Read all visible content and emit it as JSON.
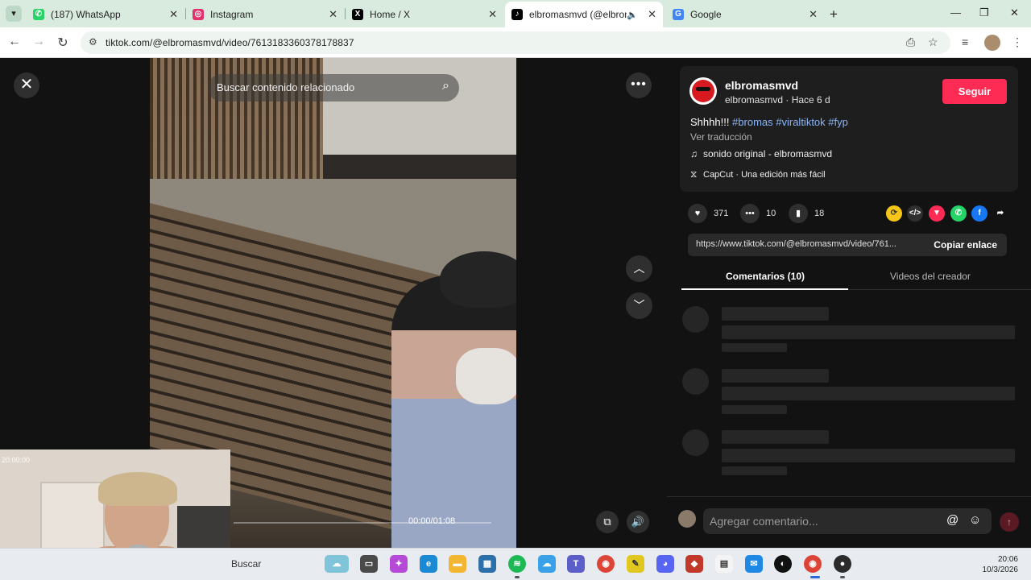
{
  "browser": {
    "tabs": [
      {
        "title": "(187) WhatsApp",
        "favicon": "whatsapp-icon",
        "color": "#25d366"
      },
      {
        "title": "Instagram",
        "favicon": "instagram-icon",
        "color": "#e1306c"
      },
      {
        "title": "Home / X",
        "favicon": "x-icon",
        "color": "#000000"
      },
      {
        "title": "elbromasmvd (@elbromasm",
        "favicon": "tiktok-icon",
        "color": "#000000",
        "active": true
      },
      {
        "title": "Google",
        "favicon": "google-icon",
        "color": "#4285f4"
      }
    ],
    "url": "tiktok.com/@elbromasmvd/video/7613183360378178837"
  },
  "video": {
    "search_placeholder": "Buscar contenido relacionado",
    "time": "00:00/01:08",
    "progress": 0
  },
  "post": {
    "username": "elbromasmvd",
    "subline": "elbromasmvd · Hace 6 d",
    "follow_label": "Seguir",
    "caption_text": "Shhhh!!! ",
    "hashtags": [
      "#bromas",
      "#viraltiktok",
      "#fyp"
    ],
    "translate": "Ver traducción",
    "sound": "sonido original - elbromasmvd",
    "capcut": "CapCut · Una edición más fácil",
    "likes": "371",
    "comments": "10",
    "saves": "18",
    "link": "https://www.tiktok.com/@elbromasmvd/video/761...",
    "copy_label": "Copiar enlace",
    "brand_color": "#fe2c55"
  },
  "panel_tabs": {
    "comments": "Comentarios (10)",
    "creator": "Videos del creador"
  },
  "comment_box": {
    "placeholder": "Agregar comentario..."
  },
  "webcam": {
    "timestamp": "20:00:00"
  },
  "taskbar": {
    "search_label": "Buscar",
    "time": "20:06",
    "date": "10/3/2026"
  }
}
